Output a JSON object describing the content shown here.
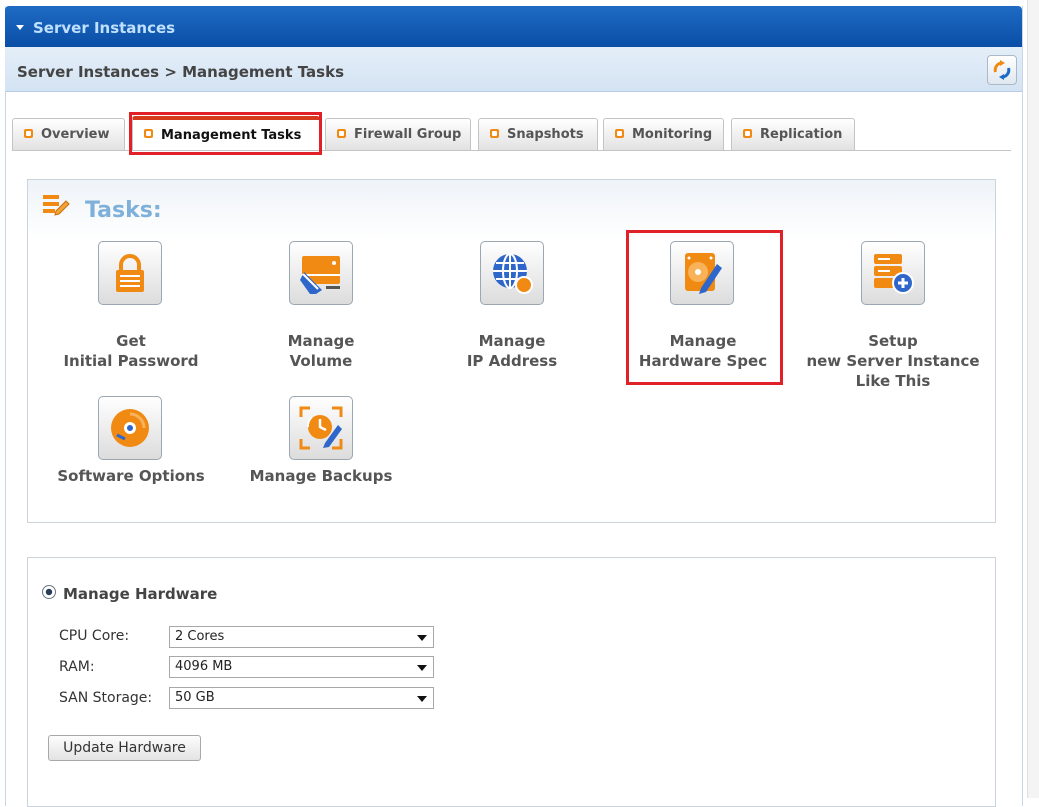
{
  "window": {
    "title": "Server Instances"
  },
  "breadcrumb": {
    "text": "Server Instances >  Management Tasks"
  },
  "tabs": [
    {
      "label": "Overview"
    },
    {
      "label": "Management Tasks"
    },
    {
      "label": "Firewall Group"
    },
    {
      "label": "Snapshots"
    },
    {
      "label": "Monitoring"
    },
    {
      "label": "Replication"
    }
  ],
  "tasks": {
    "title": "Tasks:",
    "items": [
      {
        "line1": "Get",
        "line2": "Initial Password",
        "icon": "lock-icon"
      },
      {
        "line1": "Manage",
        "line2": "Volume",
        "icon": "volume-edit-icon"
      },
      {
        "line1": "Manage",
        "line2": "IP Address",
        "icon": "globe-icon"
      },
      {
        "line1": "Manage",
        "line2": "Hardware Spec",
        "icon": "harddisk-edit-icon"
      },
      {
        "line1": "Setup",
        "line2": "new Server Instance",
        "line3": "Like This",
        "icon": "server-add-icon"
      },
      {
        "line1": "Software Options",
        "icon": "cd-icon"
      },
      {
        "line1": "Manage Backups",
        "icon": "backup-clock-icon"
      }
    ]
  },
  "hardware": {
    "title": "Manage Hardware",
    "cpu_label": "CPU Core:",
    "cpu_value": "2 Cores",
    "ram_label": "RAM:",
    "ram_value": "4096 MB",
    "storage_label": "SAN Storage:",
    "storage_value": "50 GB",
    "update_button": "Update Hardware"
  },
  "colors": {
    "header_blue": "#0a4ea6",
    "accent_orange": "#f08a12",
    "highlight_red": "#e02127",
    "tasks_title": "#7fb0d9"
  }
}
